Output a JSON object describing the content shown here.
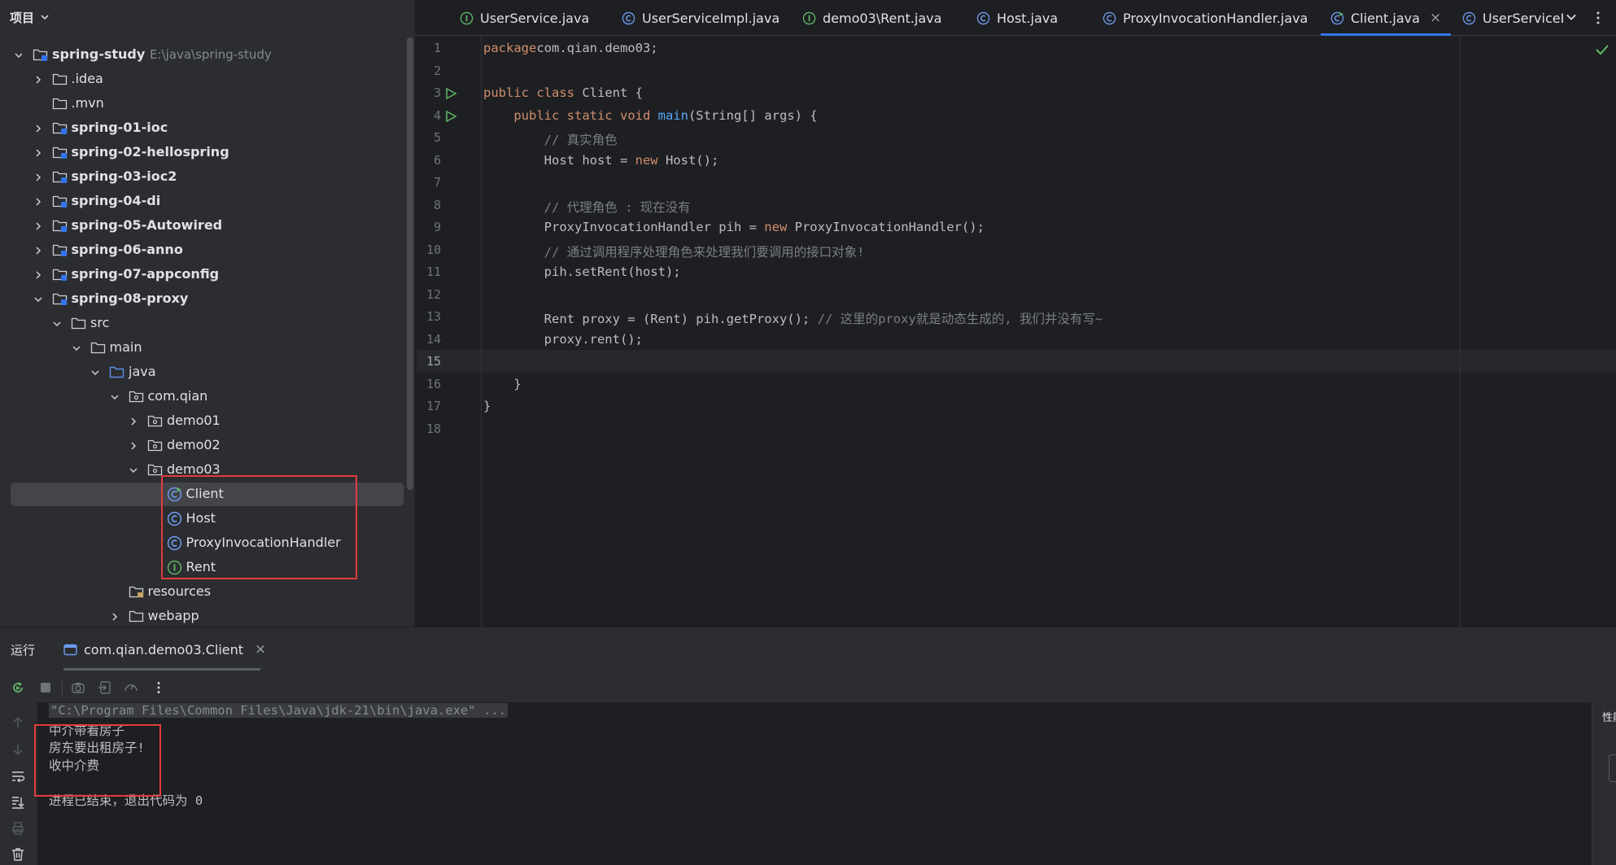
{
  "project": {
    "title": "项目",
    "tree": [
      {
        "label": "spring-study",
        "path": "E:\\java\\spring-study",
        "depth": 0,
        "expanded": true,
        "icon": "module-folder-icon",
        "bold": true
      },
      {
        "label": ".idea",
        "depth": 1,
        "expanded": false,
        "icon": "folder-icon"
      },
      {
        "label": ".mvn",
        "depth": 1,
        "icon": "folder-icon"
      },
      {
        "label": "spring-01-ioc",
        "depth": 1,
        "expanded": false,
        "icon": "module-folder-icon",
        "bold": true
      },
      {
        "label": "spring-02-hellospring",
        "depth": 1,
        "expanded": false,
        "icon": "module-folder-icon",
        "bold": true
      },
      {
        "label": "spring-03-ioc2",
        "depth": 1,
        "expanded": false,
        "icon": "module-folder-icon",
        "bold": true
      },
      {
        "label": "spring-04-di",
        "depth": 1,
        "expanded": false,
        "icon": "module-folder-icon",
        "bold": true
      },
      {
        "label": "spring-05-Autowired",
        "depth": 1,
        "expanded": false,
        "icon": "module-folder-icon",
        "bold": true
      },
      {
        "label": "spring-06-anno",
        "depth": 1,
        "expanded": false,
        "icon": "module-folder-icon",
        "bold": true
      },
      {
        "label": "spring-07-appconfig",
        "depth": 1,
        "expanded": false,
        "icon": "module-folder-icon",
        "bold": true
      },
      {
        "label": "spring-08-proxy",
        "depth": 1,
        "expanded": true,
        "icon": "module-folder-icon",
        "bold": true
      },
      {
        "label": "src",
        "depth": 2,
        "expanded": true,
        "icon": "folder-icon"
      },
      {
        "label": "main",
        "depth": 3,
        "expanded": true,
        "icon": "folder-icon"
      },
      {
        "label": "java",
        "depth": 4,
        "expanded": true,
        "icon": "source-folder-icon"
      },
      {
        "label": "com.qian",
        "depth": 5,
        "expanded": true,
        "icon": "package-icon"
      },
      {
        "label": "demo01",
        "depth": 6,
        "expanded": false,
        "icon": "package-icon"
      },
      {
        "label": "demo02",
        "depth": 6,
        "expanded": false,
        "icon": "package-icon"
      },
      {
        "label": "demo03",
        "depth": 6,
        "expanded": true,
        "icon": "package-icon"
      },
      {
        "label": "Client",
        "depth": 7,
        "icon": "runnable-class-icon",
        "selected": true
      },
      {
        "label": "Host",
        "depth": 7,
        "icon": "class-icon"
      },
      {
        "label": "ProxyInvocationHandler",
        "depth": 7,
        "icon": "class-icon"
      },
      {
        "label": "Rent",
        "depth": 7,
        "icon": "interface-icon"
      },
      {
        "label": "resources",
        "depth": 5,
        "icon": "resources-folder-icon"
      },
      {
        "label": "webapp",
        "depth": 5,
        "expanded": false,
        "icon": "folder-icon"
      }
    ]
  },
  "editor": {
    "tabs": [
      {
        "label": "UserService.java",
        "icon": "interface-icon"
      },
      {
        "label": "UserServiceImpl.java",
        "icon": "class-icon"
      },
      {
        "label": "demo03\\Rent.java",
        "icon": "interface-icon"
      },
      {
        "label": "Host.java",
        "icon": "class-icon"
      },
      {
        "label": "ProxyInvocationHandler.java",
        "icon": "class-icon"
      },
      {
        "label": "Client.java",
        "icon": "runnable-class-icon",
        "active": true,
        "closable": true
      },
      {
        "label": "UserServiceI",
        "icon": "class-icon"
      }
    ],
    "current_line": 15,
    "run_gutter_lines": [
      3,
      4
    ],
    "lines": [
      [
        [
          "kw",
          "package"
        ],
        [
          "",
          "com.qian.demo03;"
        ]
      ],
      [],
      [
        [
          "kw",
          "public class "
        ],
        [
          "",
          "Client {"
        ]
      ],
      [
        [
          "",
          "    "
        ],
        [
          "kw",
          "public static void "
        ],
        [
          "fn",
          "main"
        ],
        [
          "",
          "(String[] args) {"
        ]
      ],
      [
        [
          "",
          "        "
        ],
        [
          "cm",
          "// 真实角色"
        ]
      ],
      [
        [
          "",
          "        Host host = "
        ],
        [
          "kw",
          "new "
        ],
        [
          "",
          "Host();"
        ]
      ],
      [],
      [
        [
          "",
          "        "
        ],
        [
          "cm",
          "// 代理角色 : 现在没有"
        ]
      ],
      [
        [
          "",
          "        ProxyInvocationHandler pih = "
        ],
        [
          "kw",
          "new "
        ],
        [
          "",
          "ProxyInvocationHandler();"
        ]
      ],
      [
        [
          "",
          "        "
        ],
        [
          "cm",
          "// 通过调用程序处理角色来处理我们要调用的接口对象!"
        ]
      ],
      [
        [
          "",
          "        pih.setRent(host);"
        ]
      ],
      [],
      [
        [
          "",
          "        Rent proxy = (Rent) pih.getProxy(); "
        ],
        [
          "cm",
          "// 这里的proxy就是动态生成的, 我们并没有写~"
        ]
      ],
      [
        [
          "",
          "        proxy.rent();"
        ]
      ],
      [],
      [
        [
          "",
          "    }"
        ]
      ],
      [
        [
          "",
          "}"
        ]
      ],
      []
    ]
  },
  "run": {
    "title": "运行",
    "tab_label": "com.qian.demo03.Client",
    "console": [
      {
        "text": "\"C:\\Program Files\\Common Files\\Java\\jdk-21\\bin\\java.exe\" ...",
        "kind": "cmd"
      },
      {
        "text": "中介带看房子",
        "kind": "out"
      },
      {
        "text": "房东要出租房子!",
        "kind": "out"
      },
      {
        "text": "收中介费",
        "kind": "out"
      },
      {
        "text": "",
        "kind": "out"
      },
      {
        "text": "进程已结束，退出代码为 0",
        "kind": "out"
      }
    ],
    "right_strip_label": "性能"
  }
}
